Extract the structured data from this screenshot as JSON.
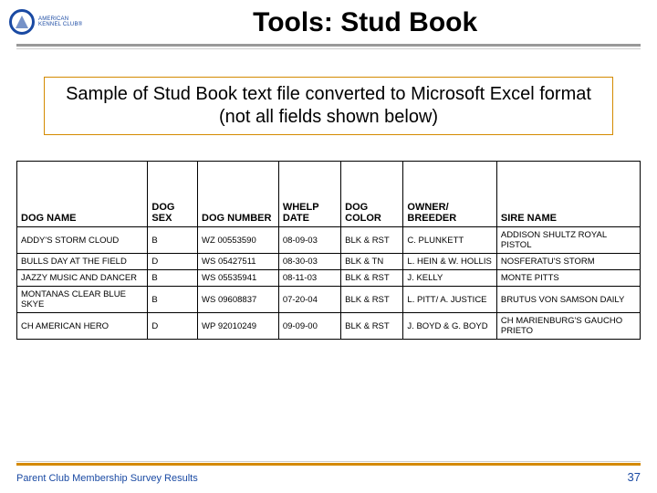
{
  "header": {
    "logo_line1": "AMERICAN",
    "logo_line2": "KENNEL CLUB®",
    "title": "Tools: Stud Book"
  },
  "caption": "Sample of Stud Book text file converted to Microsoft Excel format (not all fields shown below)",
  "table": {
    "headers": [
      "DOG NAME",
      "DOG SEX",
      "DOG NUMBER",
      "WHELP DATE",
      "DOG COLOR",
      "OWNER/ BREEDER",
      "SIRE NAME"
    ],
    "rows": [
      [
        "ADDY'S STORM CLOUD",
        "B",
        "WZ 00553590",
        "08-09-03",
        "BLK & RST",
        "C. PLUNKETT",
        "ADDISON SHULTZ ROYAL PISTOL"
      ],
      [
        "BULLS DAY AT THE FIELD",
        "D",
        "WS 05427511",
        "08-30-03",
        "BLK & TN",
        "L. HEIN & W. HOLLIS",
        "NOSFERATU'S STORM"
      ],
      [
        "JAZZY MUSIC AND DANCER",
        "B",
        "WS 05535941",
        "08-11-03",
        "BLK & RST",
        "J. KELLY",
        "MONTE PITTS"
      ],
      [
        "MONTANAS CLEAR BLUE SKYE",
        "B",
        "WS 09608837",
        "07-20-04",
        "BLK & RST",
        "L. PITT/ A. JUSTICE",
        "BRUTUS VON SAMSON DAILY"
      ],
      [
        "CH AMERICAN HERO",
        "D",
        "WP 92010249",
        "09-09-00",
        "BLK & RST",
        "J. BOYD & G. BOYD",
        "CH MARIENBURG'S GAUCHO PRIETO"
      ]
    ]
  },
  "footer": {
    "left": "Parent Club Membership Survey Results",
    "page": "37"
  }
}
